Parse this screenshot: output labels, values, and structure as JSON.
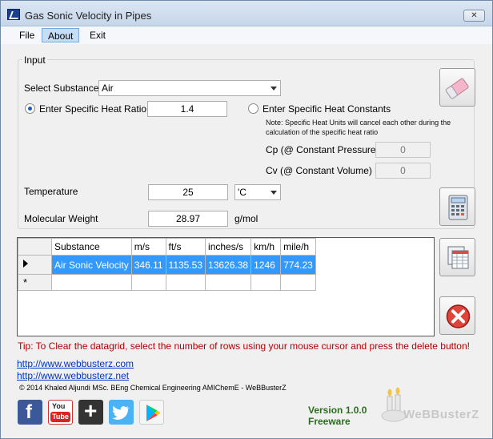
{
  "window": {
    "title": "Gas Sonic Velocity in Pipes",
    "close_label": "✕"
  },
  "menu": {
    "file": "File",
    "about": "About",
    "exit": "Exit"
  },
  "input": {
    "group_label": "Input",
    "substance_label": "Select Substance",
    "substance_value": "Air",
    "ratio_option": "Enter Specific Heat Ratio",
    "ratio_value": "1.4",
    "constants_option": "Enter Specific Heat Constants",
    "note": "Note: Specific Heat Units will cancel each other during the calculation of the specific heat ratio",
    "cp_label": "Cp (@ Constant Pressure)",
    "cp_value": "0",
    "cv_label": "Cv (@ Constant Volume)",
    "cv_value": "0",
    "temperature_label": "Temperature",
    "temperature_value": "25",
    "temperature_unit": "'C",
    "mw_label": "Molecular Weight",
    "mw_value": "28.97",
    "mw_unit": "g/mol"
  },
  "grid": {
    "columns": [
      "Substance",
      "m/s",
      "ft/s",
      "inches/s",
      "km/h",
      "mile/h"
    ],
    "rows": [
      [
        "Air Sonic Velocity",
        "346.11",
        "1135.53",
        "13626.38",
        "1246",
        "774.23"
      ]
    ],
    "new_row_marker": "*"
  },
  "tip": "Tip: To Clear the datagrid, select the number of rows using your mouse cursor and press the delete button!",
  "links": [
    "http://www.webbusterz.com",
    "http://www.webbusterz.net"
  ],
  "copyright": "© 2014 Khaled Aljundi MSc. BEng Chemical Engineering AMIChemE - WeBBusterZ",
  "social": {
    "facebook": "f",
    "youtube_top": "You",
    "youtube_bottom": "Tube",
    "plus": "+"
  },
  "version": {
    "line1": "Version 1.0.0",
    "line2": "Freeware"
  },
  "logo": "WeBBusterZ",
  "colors": {
    "selection": "#3399ff",
    "tip": "#b30000",
    "link": "#0033cc",
    "version": "#2a6e1c"
  }
}
